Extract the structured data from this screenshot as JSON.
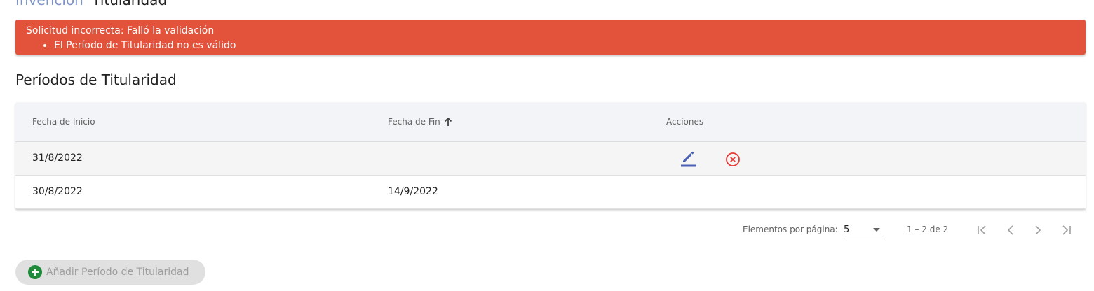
{
  "breadcrumb": {
    "parent": "Invención",
    "current": "Titularidad"
  },
  "alert": {
    "title": "Solicitud incorrecta: Falló la validación",
    "items": [
      "El Período de Titularidad no es válido"
    ],
    "color": "#e3523a"
  },
  "section": {
    "title": "Períodos de Titularidad"
  },
  "table": {
    "columns": [
      "Fecha de Inicio",
      "Fecha de Fin",
      "Acciones"
    ],
    "sort": {
      "column": "Fecha de Fin",
      "direction": "asc",
      "icon": "arrow-up-icon"
    },
    "rows": [
      {
        "inicio": "31/8/2022",
        "fin": "",
        "actions": [
          "edit-icon",
          "cancel-circle-icon"
        ]
      },
      {
        "inicio": "30/8/2022",
        "fin": "14/9/2022",
        "actions": []
      }
    ]
  },
  "paginator": {
    "label": "Elementos por página:",
    "page_size": "5",
    "range": "1 – 2 de 2",
    "nav_icons": [
      "first-page-icon",
      "prev-page-icon",
      "next-page-icon",
      "last-page-icon"
    ]
  },
  "add_button": {
    "label": "Añadir Período de Titularidad",
    "icon": "add-circle-icon",
    "icon_color": "#1e8a3a"
  },
  "colors": {
    "edit_icon": "#4a5fb5",
    "delete_icon": "#e53935",
    "link": "#7f95c9"
  }
}
